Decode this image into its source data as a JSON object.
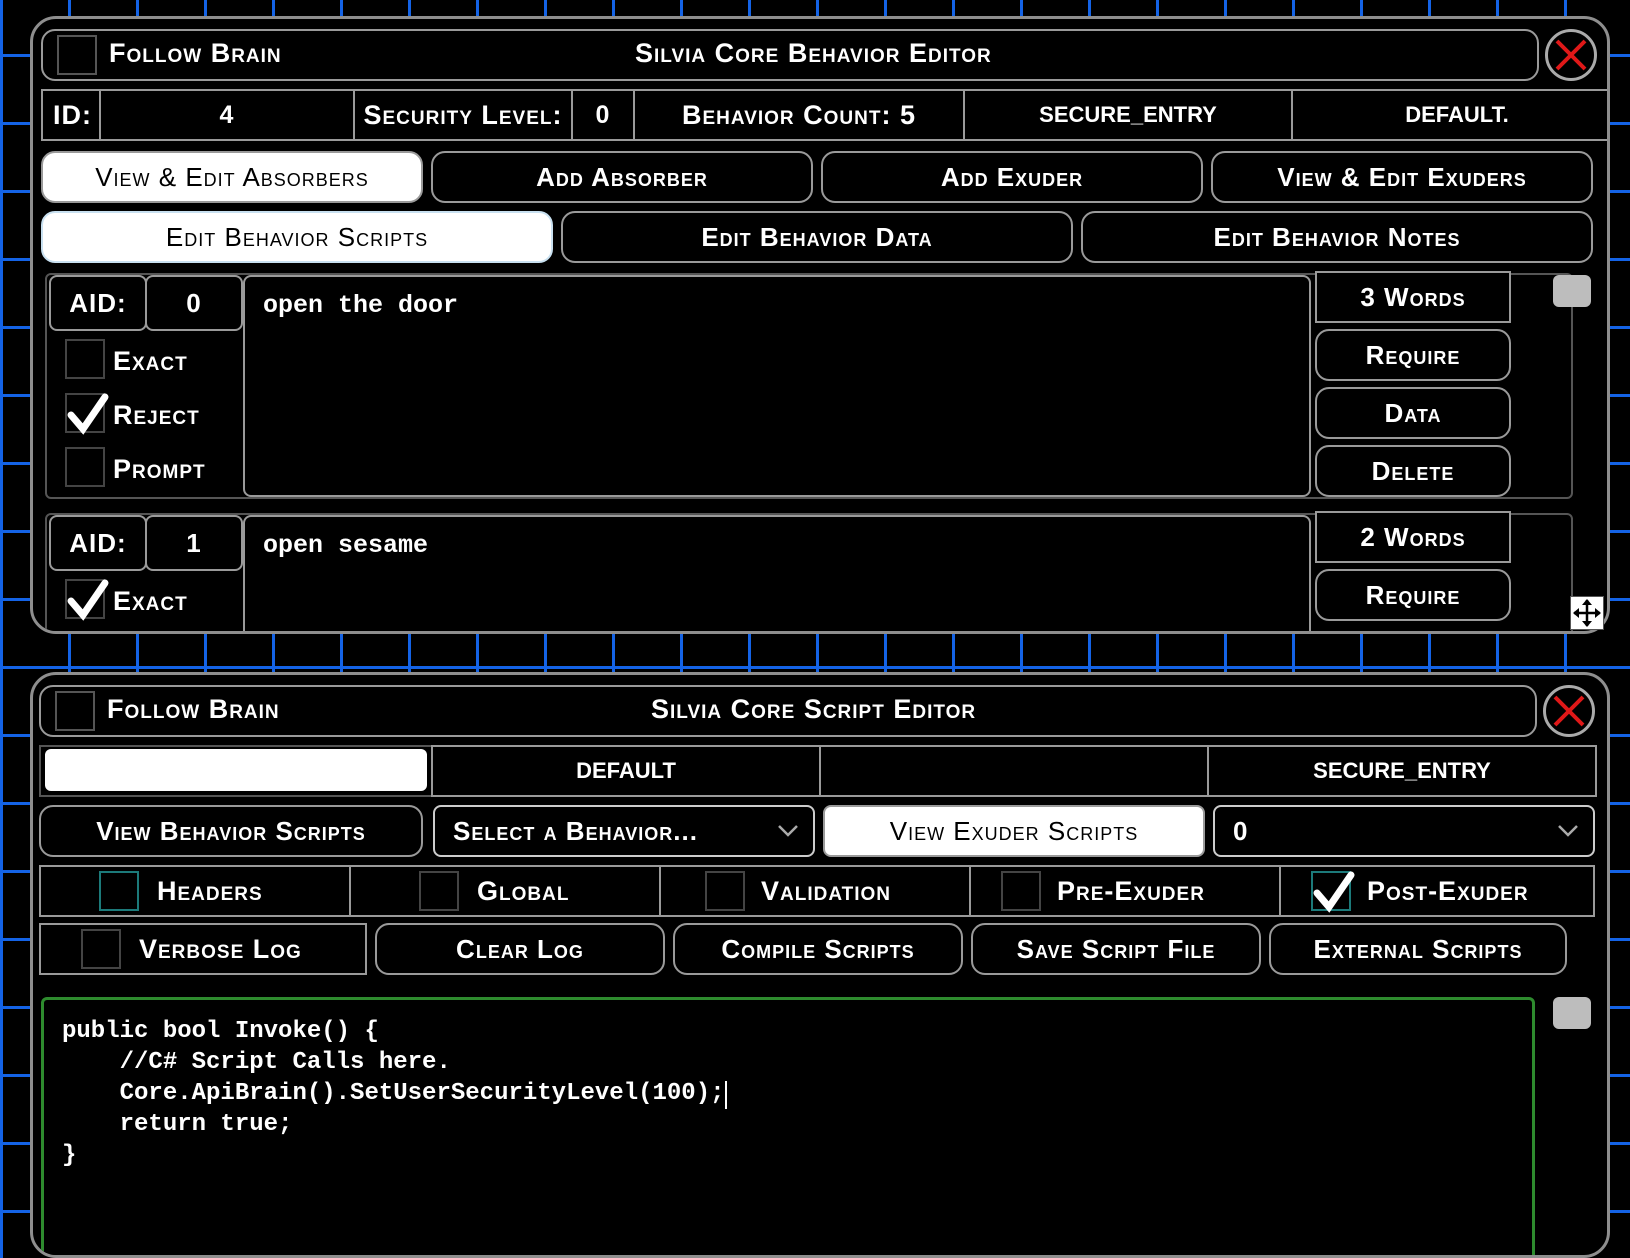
{
  "behavior_editor": {
    "follow_label": "Follow Brain",
    "title": "Silvia Core Behavior Editor",
    "id_label": "ID:",
    "id_value": "4",
    "security_label": "Security Level:",
    "security_value": "0",
    "behavior_count": "Behavior Count: 5",
    "entry_name": "SECURE_ENTRY",
    "group_name": "DEFAULT.",
    "tabs_row1": [
      "View & Edit Absorbers",
      "Add Absorber",
      "Add Exuder",
      "View & Edit Exuders"
    ],
    "tabs_row2": [
      "Edit Behavior Scripts",
      "Edit Behavior Data",
      "Edit Behavior Notes"
    ],
    "absorbers": [
      {
        "aid_label": "AID:",
        "aid_value": "0",
        "text": "open the door",
        "words": "3 Words",
        "options": [
          {
            "label": "Exact",
            "checked": false
          },
          {
            "label": "Reject",
            "checked": true
          },
          {
            "label": "Prompt",
            "checked": false
          }
        ],
        "actions": [
          "Require",
          "Data",
          "Delete"
        ]
      },
      {
        "aid_label": "AID:",
        "aid_value": "1",
        "text": "open sesame",
        "words": "2 Words",
        "options": [
          {
            "label": "Exact",
            "checked": true
          }
        ],
        "actions": [
          "Require"
        ]
      }
    ]
  },
  "script_editor": {
    "follow_label": "Follow Brain",
    "title": "Silvia Core Script Editor",
    "input_value": "",
    "group_name": "DEFAULT",
    "entry_name": "SECURE_ENTRY",
    "view_behavior_scripts": "View Behavior Scripts",
    "select_behavior": "Select a Behavior...",
    "view_exuder_scripts": "View Exuder Scripts",
    "exuder_select": "0",
    "filters": [
      {
        "label": "Headers",
        "checked": false
      },
      {
        "label": "Global",
        "checked": false
      },
      {
        "label": "Validation",
        "checked": false
      },
      {
        "label": "Pre-Exuder",
        "checked": false
      },
      {
        "label": "Post-Exuder",
        "checked": true
      }
    ],
    "verbose_log": "Verbose Log",
    "buttons": [
      "Clear Log",
      "Compile Scripts",
      "Save Script File",
      "External Scripts"
    ],
    "code_lines": [
      "public bool Invoke() {",
      "    //C# Script Calls here.",
      "    Core.ApiBrain().SetUserSecurityLevel(100);",
      "    return true;",
      "}"
    ]
  },
  "icons": [
    "close-icon",
    "check-icon",
    "move-icon",
    "chevron-down-icon"
  ],
  "colors": {
    "grid": "#1463e6",
    "close": "#e01818",
    "border": "#9a9a9a",
    "background": "#000000"
  }
}
